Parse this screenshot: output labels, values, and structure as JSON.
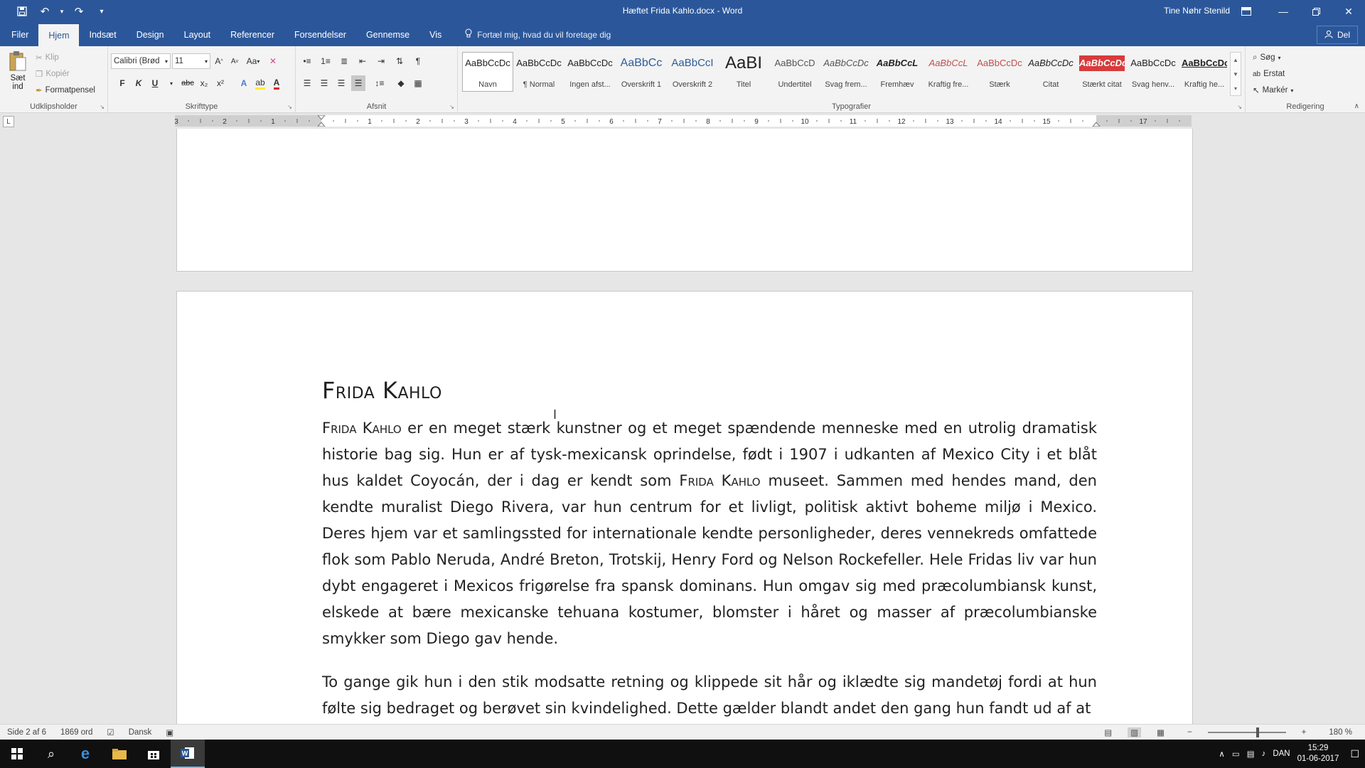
{
  "window": {
    "title": "Hæftet Frida Kahlo.docx - Word",
    "user": "Tine Nøhr Stenild",
    "minimize_icon": "minimize-icon",
    "restore_icon": "restore-icon",
    "close_icon": "close-icon"
  },
  "tabs": [
    {
      "label": "Filer"
    },
    {
      "label": "Hjem"
    },
    {
      "label": "Indsæt"
    },
    {
      "label": "Design"
    },
    {
      "label": "Layout"
    },
    {
      "label": "Referencer"
    },
    {
      "label": "Forsendelser"
    },
    {
      "label": "Gennemse"
    },
    {
      "label": "Vis"
    }
  ],
  "active_tab": "Hjem",
  "tellme": "Fortæl mig, hvad du vil foretage dig",
  "share": "Del",
  "ribbon": {
    "clipboard": {
      "label": "Udklipsholder",
      "paste": "Sæt",
      "paste2": "ind",
      "cut": "Klip",
      "copy": "Kopiér",
      "format_painter": "Formatpensel"
    },
    "font": {
      "label": "Skrifttype",
      "font_name": "Calibri (Brød",
      "font_size": "11",
      "bold": "F",
      "italic": "K",
      "underline": "U",
      "strike": "abc",
      "subscript": "x₂",
      "superscript": "x²",
      "case": "Aa",
      "grow": "A",
      "shrink": "A"
    },
    "paragraph": {
      "label": "Afsnit",
      "pilcrow": "¶"
    },
    "styles": {
      "label": "Typografier",
      "items": [
        {
          "sample": "AaBbCcDc",
          "name": "Navn"
        },
        {
          "sample": "AaBbCcDc",
          "name": "¶ Normal"
        },
        {
          "sample": "AaBbCcDc",
          "name": "Ingen afst..."
        },
        {
          "sample": "AaBbCc",
          "name": "Overskrift 1"
        },
        {
          "sample": "AaBbCcI",
          "name": "Overskrift 2"
        },
        {
          "sample": "AaBI",
          "name": "Titel"
        },
        {
          "sample": "AaBbCcD",
          "name": "Undertitel"
        },
        {
          "sample": "AaBbCcDc",
          "name": "Svag frem..."
        },
        {
          "sample": "AaBbCcL",
          "name": "Fremhæv"
        },
        {
          "sample": "AaBbCcL",
          "name": "Kraftig fre..."
        },
        {
          "sample": "AaBbCcDc",
          "name": "Stærk"
        },
        {
          "sample": "AaBbCcDc",
          "name": "Citat"
        },
        {
          "sample": "AaBbCcDc",
          "name": "Stærkt citat"
        },
        {
          "sample": "AaBbCcDc",
          "name": "Svag henv..."
        },
        {
          "sample": "AaBbCcDc",
          "name": "Kraftig he..."
        }
      ]
    },
    "editing": {
      "label": "Redigering",
      "find": "Søg",
      "replace": "Erstat",
      "select": "Markér"
    }
  },
  "ruler": {
    "ticks": [
      "3",
      "2",
      "1",
      "1",
      "2",
      "3",
      "4",
      "5",
      "6",
      "7",
      "8",
      "9",
      "10",
      "11",
      "12",
      "13",
      "14",
      "15",
      "17"
    ]
  },
  "document": {
    "heading": "Frida Kahlo",
    "para1_name": "Frida Kahlo",
    "para1_a": " er en meget stærk kunstner og et meget spændende menneske med en utrolig dramatisk historie bag sig. Hun er af tysk-mexicansk oprindelse, født i 1907 i udkanten af Mexico City i et blåt hus kaldet Coyocán, der i dag er kendt som ",
    "para1_name2": "Frida Kahlo",
    "para1_b": " museet. Sammen med hendes mand, den kendte muralist Diego Rivera, var hun centrum for et livligt, politisk aktivt boheme miljø i Mexico. Deres hjem var et samlingssted for internationale kendte personligheder, deres vennekreds omfattede flok som Pablo Neruda, André Breton, Trotskij, Henry Ford og Nelson Rockefeller. Hele Fridas liv var hun dybt engageret i Mexicos frigørelse fra spansk dominans. Hun omgav sig med præcolumbiansk kunst, elskede at bære mexicanske tehuana kostumer, blomster i håret og masser af præcolumbianske smykker som Diego gav hende.",
    "para2": "To gange gik hun i den stik modsatte retning og klippede sit hår og iklædte sig mandetøj fordi at hun følte sig bedraget og berøvet sin kvindelighed. Dette gælder blandt andet den gang hun fandt ud af at"
  },
  "status": {
    "page": "Side 2 af 6",
    "words": "1869 ord",
    "language": "Dansk",
    "zoom": "180 %",
    "zoom_level": 180
  },
  "taskbar": {
    "lang": "DAN",
    "time": "15:29",
    "date": "01-06-2017"
  },
  "colors": {
    "accent": "#2b579a",
    "style_strong_quote_bg": "#d83b3b"
  }
}
